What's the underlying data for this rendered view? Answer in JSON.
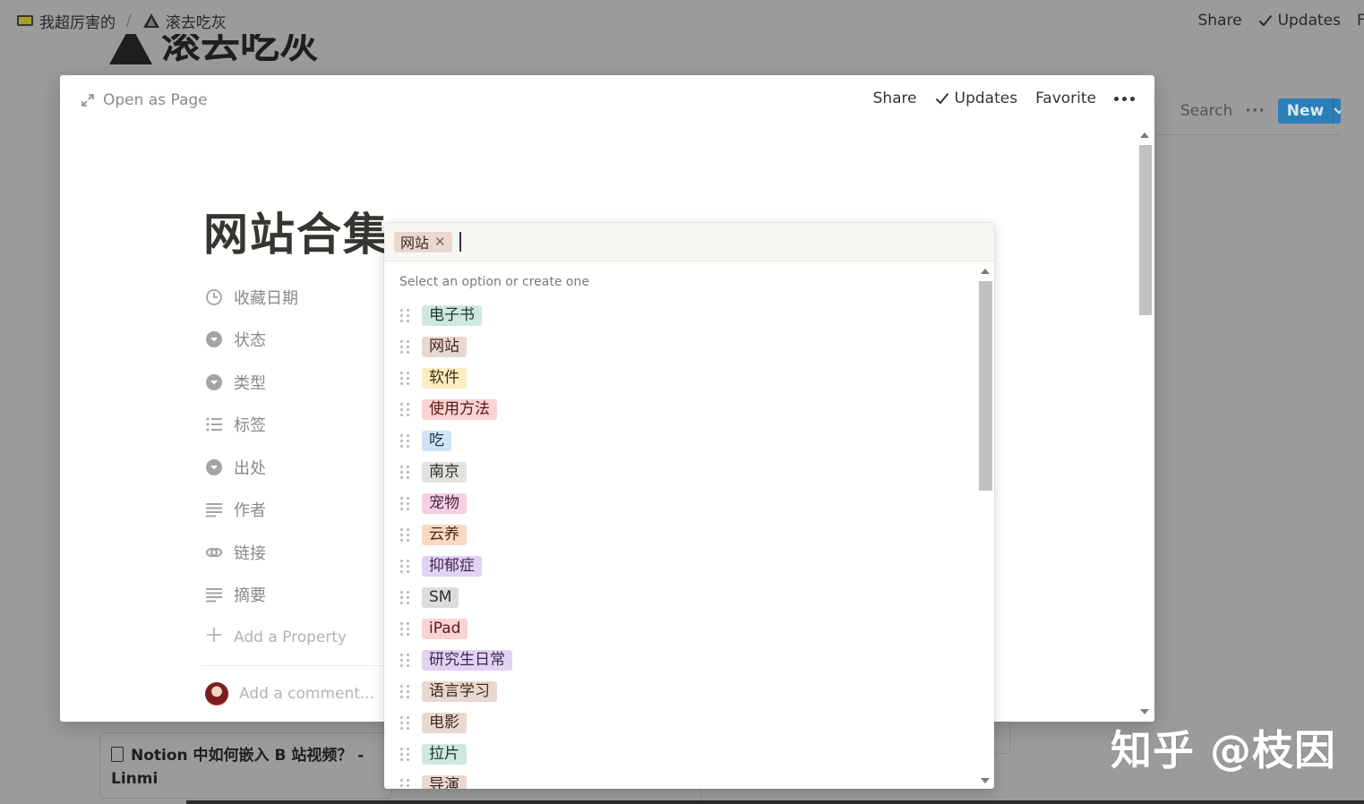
{
  "background": {
    "breadcrumb": [
      {
        "label": "我超厉害的",
        "icon": "monitor-icon"
      },
      {
        "label": "滚去吃灰",
        "icon": "mountain-icon"
      }
    ],
    "breadcrumb_separator": "/",
    "share_label": "Share",
    "updates_label": "Updates",
    "truncated_label": "F",
    "page_title": "滚去吃灰",
    "search_label": "Search",
    "new_label": "New",
    "card_title_line1": "Notion 中如何嵌入 B 站视频？ -",
    "card_title_line2": "Linmi"
  },
  "modal": {
    "open_as_page": "Open as Page",
    "share": "Share",
    "updates": "Updates",
    "favorite": "Favorite",
    "title": "网站合集",
    "properties": [
      {
        "label": "收藏日期",
        "icon": "clock-icon"
      },
      {
        "label": "状态",
        "icon": "select-icon"
      },
      {
        "label": "类型",
        "icon": "select-icon"
      },
      {
        "label": "标签",
        "icon": "multi-select-icon"
      },
      {
        "label": "出处",
        "icon": "select-icon"
      },
      {
        "label": "作者",
        "icon": "text-icon"
      },
      {
        "label": "链接",
        "icon": "link-icon"
      },
      {
        "label": "摘要",
        "icon": "text-icon"
      }
    ],
    "add_property": "Add a Property",
    "add_comment": "Add a comment..."
  },
  "dropdown": {
    "selected": {
      "label": "网站",
      "bg": "#e9d8cf",
      "color": "#442a1e"
    },
    "hint": "Select an option or create one",
    "options": [
      {
        "label": "电子书",
        "bg": "#cfe8df",
        "color": "#1c3829"
      },
      {
        "label": "网站",
        "bg": "#e9d8cf",
        "color": "#442a1e"
      },
      {
        "label": "软件",
        "bg": "#fbeec1",
        "color": "#402c1b"
      },
      {
        "label": "使用方法",
        "bg": "#fbd3d3",
        "color": "#5d1715"
      },
      {
        "label": "吃",
        "bg": "#cfe5f7",
        "color": "#183347"
      },
      {
        "label": "南京",
        "bg": "#e3e2e0",
        "color": "#32302c"
      },
      {
        "label": "宠物",
        "bg": "#f5cfe4",
        "color": "#4c2337"
      },
      {
        "label": "云养",
        "bg": "#fad9c1",
        "color": "#49290e"
      },
      {
        "label": "抑郁症",
        "bg": "#e1d3f2",
        "color": "#412454"
      },
      {
        "label": "SM",
        "bg": "#dcdcdb",
        "color": "#32302c"
      },
      {
        "label": "iPad",
        "bg": "#fbd3d3",
        "color": "#5d1715"
      },
      {
        "label": "研究生日常",
        "bg": "#e1d3f2",
        "color": "#412454"
      },
      {
        "label": "语言学习",
        "bg": "#e9d8cf",
        "color": "#442a1e"
      },
      {
        "label": "电影",
        "bg": "#e9d8cf",
        "color": "#442a1e"
      },
      {
        "label": "拉片",
        "bg": "#cfe8df",
        "color": "#1c3829"
      },
      {
        "label": "导演",
        "bg": "#e9d8cf",
        "color": "#442a1e"
      }
    ]
  },
  "watermark": "知乎 @枝因"
}
